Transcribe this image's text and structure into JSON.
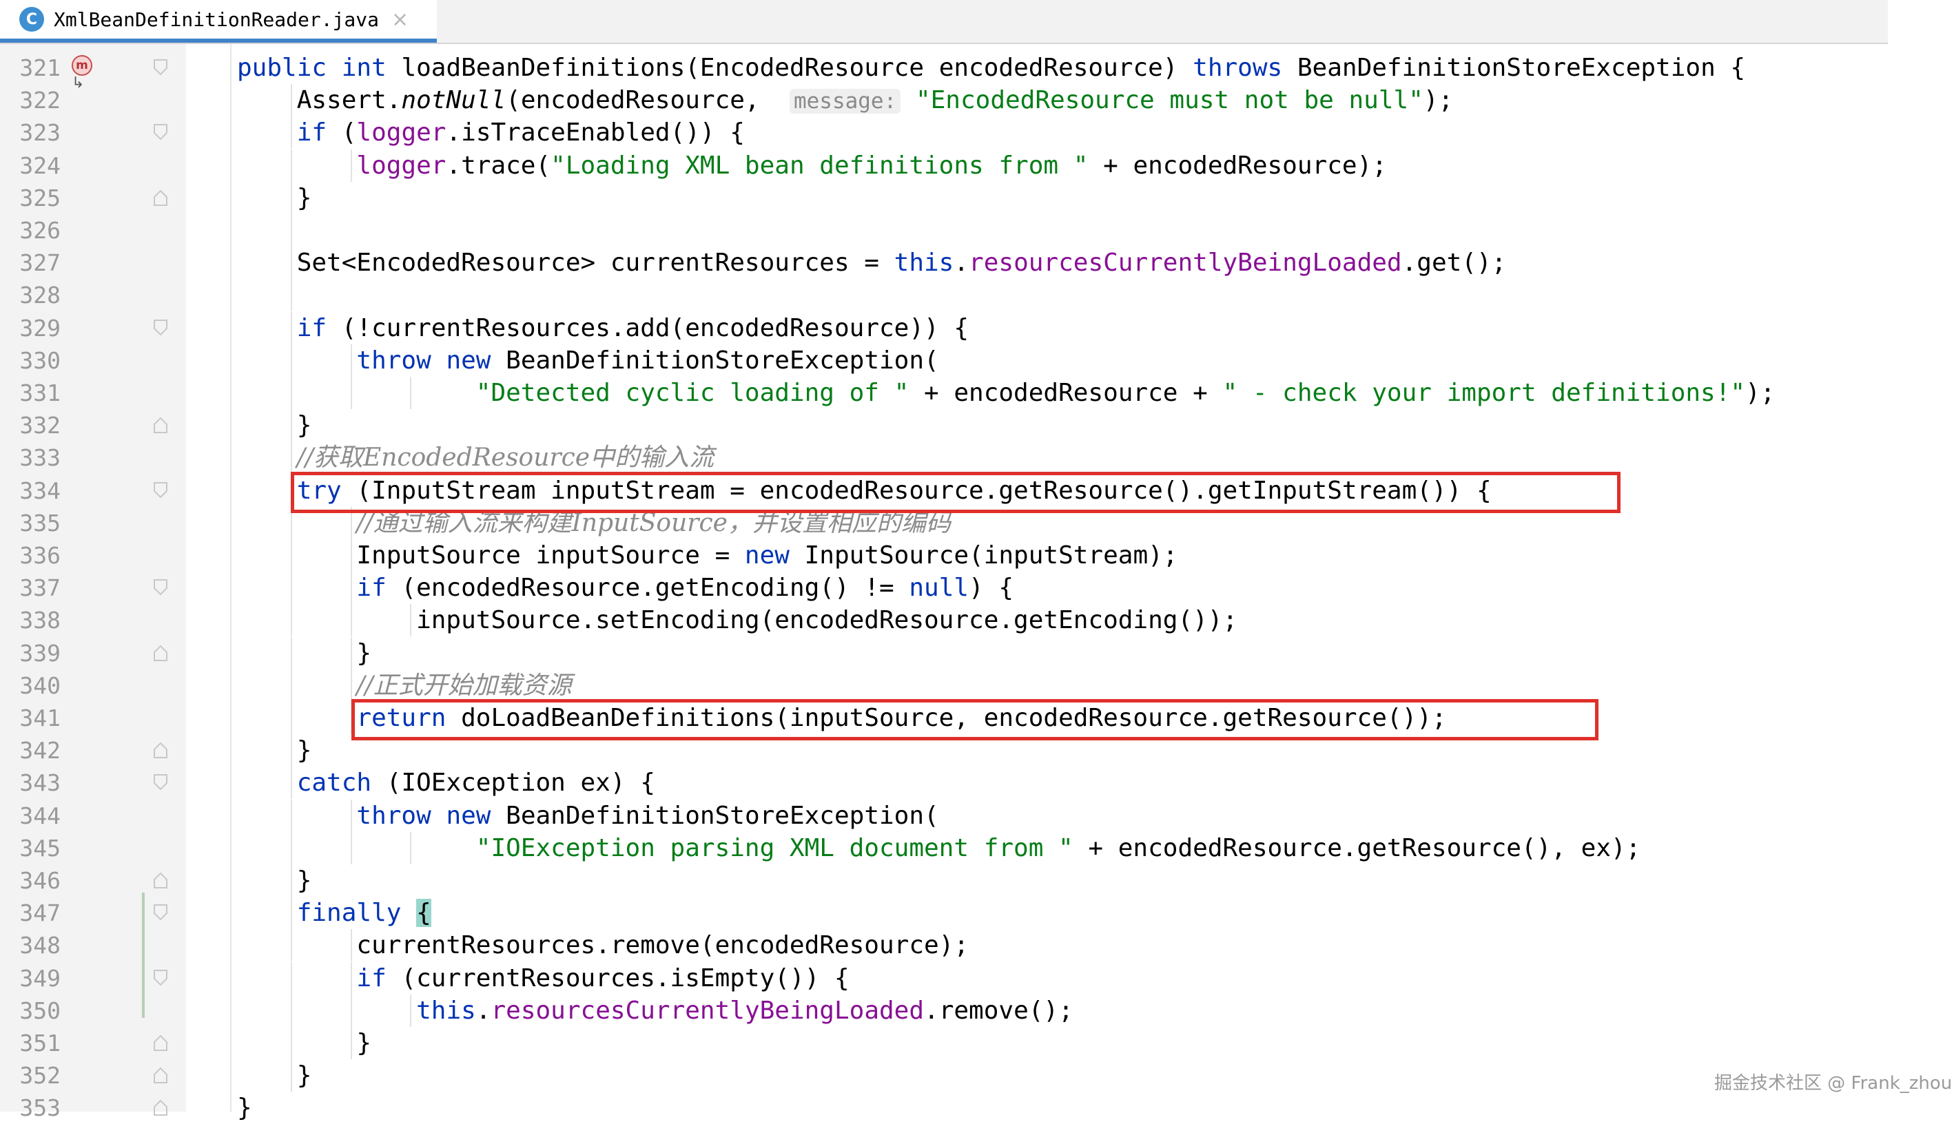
{
  "tab": {
    "icon_letter": "C",
    "file_name": "XmlBeanDefinitionReader.java",
    "close_glyph": "×"
  },
  "gutter": {
    "method_icon_letter": "m"
  },
  "lines": [
    {
      "num": "321",
      "tokens": [
        {
          "t": "public",
          "c": "kw"
        },
        {
          "t": " "
        },
        {
          "t": "int",
          "c": "kw"
        },
        {
          "t": " loadBeanDefinitions(EncodedResource encodedResource) "
        },
        {
          "t": "throws",
          "c": "kw"
        },
        {
          "t": " BeanDefinitionStoreException {"
        }
      ]
    },
    {
      "num": "322",
      "tokens": [
        {
          "t": "    Assert."
        },
        {
          "t": "notNull",
          "c": "it"
        },
        {
          "t": "(encodedResource,  "
        },
        {
          "t": "message:",
          "c": "hint"
        },
        {
          "t": " "
        },
        {
          "t": "\"EncodedResource must not be null\"",
          "c": "str"
        },
        {
          "t": ");"
        }
      ]
    },
    {
      "num": "323",
      "tokens": [
        {
          "t": "    "
        },
        {
          "t": "if",
          "c": "kw"
        },
        {
          "t": " ("
        },
        {
          "t": "logger",
          "c": "fld"
        },
        {
          "t": ".isTraceEnabled()) {"
        }
      ]
    },
    {
      "num": "324",
      "tokens": [
        {
          "t": "        "
        },
        {
          "t": "logger",
          "c": "fld"
        },
        {
          "t": ".trace("
        },
        {
          "t": "\"Loading XML bean definitions from \"",
          "c": "str"
        },
        {
          "t": " + encodedResource);"
        }
      ]
    },
    {
      "num": "325",
      "tokens": [
        {
          "t": "    }"
        }
      ]
    },
    {
      "num": "326",
      "tokens": []
    },
    {
      "num": "327",
      "tokens": [
        {
          "t": "    Set<EncodedResource> currentResources = "
        },
        {
          "t": "this",
          "c": "kw"
        },
        {
          "t": "."
        },
        {
          "t": "resourcesCurrentlyBeingLoaded",
          "c": "fld"
        },
        {
          "t": ".get();"
        }
      ]
    },
    {
      "num": "328",
      "tokens": []
    },
    {
      "num": "329",
      "tokens": [
        {
          "t": "    "
        },
        {
          "t": "if",
          "c": "kw"
        },
        {
          "t": " (!currentResources.add(encodedResource)) {"
        }
      ]
    },
    {
      "num": "330",
      "tokens": [
        {
          "t": "        "
        },
        {
          "t": "throw",
          "c": "kw"
        },
        {
          "t": " "
        },
        {
          "t": "new",
          "c": "kw"
        },
        {
          "t": " BeanDefinitionStoreException("
        }
      ]
    },
    {
      "num": "331",
      "tokens": [
        {
          "t": "                "
        },
        {
          "t": "\"Detected cyclic loading of \"",
          "c": "str"
        },
        {
          "t": " + encodedResource + "
        },
        {
          "t": "\" - check your import definitions!\"",
          "c": "str"
        },
        {
          "t": ");"
        }
      ]
    },
    {
      "num": "332",
      "tokens": [
        {
          "t": "    }"
        }
      ]
    },
    {
      "num": "333",
      "tokens": [
        {
          "t": "    "
        },
        {
          "t": "//获取EncodedResource中的输入流",
          "c": "cmt"
        }
      ]
    },
    {
      "num": "334",
      "tokens": [
        {
          "t": "    "
        },
        {
          "t": "try",
          "c": "kw"
        },
        {
          "t": " (InputStream inputStream = encodedResource.getResource().getInputStream()) {"
        }
      ]
    },
    {
      "num": "335",
      "tokens": [
        {
          "t": "        "
        },
        {
          "t": "//通过输入流来构建InputSource，并设置相应的编码",
          "c": "cmt"
        }
      ]
    },
    {
      "num": "336",
      "tokens": [
        {
          "t": "        InputSource inputSource = "
        },
        {
          "t": "new",
          "c": "kw"
        },
        {
          "t": " InputSource(inputStream);"
        }
      ]
    },
    {
      "num": "337",
      "tokens": [
        {
          "t": "        "
        },
        {
          "t": "if",
          "c": "kw"
        },
        {
          "t": " (encodedResource.getEncoding() != "
        },
        {
          "t": "null",
          "c": "kw"
        },
        {
          "t": ") {"
        }
      ]
    },
    {
      "num": "338",
      "tokens": [
        {
          "t": "            inputSource.setEncoding(encodedResource.getEncoding());"
        }
      ]
    },
    {
      "num": "339",
      "tokens": [
        {
          "t": "        }"
        }
      ]
    },
    {
      "num": "340",
      "tokens": [
        {
          "t": "        "
        },
        {
          "t": "//正式开始加载资源",
          "c": "cmt"
        }
      ]
    },
    {
      "num": "341",
      "tokens": [
        {
          "t": "        "
        },
        {
          "t": "return",
          "c": "kw"
        },
        {
          "t": " doLoadBeanDefinitions(inputSource, encodedResource.getResource());"
        }
      ]
    },
    {
      "num": "342",
      "tokens": [
        {
          "t": "    }"
        }
      ]
    },
    {
      "num": "343",
      "tokens": [
        {
          "t": "    "
        },
        {
          "t": "catch",
          "c": "kw"
        },
        {
          "t": " (IOException ex) {"
        }
      ]
    },
    {
      "num": "344",
      "tokens": [
        {
          "t": "        "
        },
        {
          "t": "throw",
          "c": "kw"
        },
        {
          "t": " "
        },
        {
          "t": "new",
          "c": "kw"
        },
        {
          "t": " BeanDefinitionStoreException("
        }
      ]
    },
    {
      "num": "345",
      "tokens": [
        {
          "t": "                "
        },
        {
          "t": "\"IOException parsing XML document from \"",
          "c": "str"
        },
        {
          "t": " + encodedResource.getResource(), ex);"
        }
      ]
    },
    {
      "num": "346",
      "tokens": [
        {
          "t": "    }"
        }
      ]
    },
    {
      "num": "347",
      "tokens": [
        {
          "t": "    "
        },
        {
          "t": "finally",
          "c": "kw"
        },
        {
          "t": " "
        },
        {
          "t": "{",
          "c": "brace-hl"
        }
      ]
    },
    {
      "num": "348",
      "tokens": [
        {
          "t": "        currentResources.remove(encodedResource);"
        }
      ]
    },
    {
      "num": "349",
      "tokens": [
        {
          "t": "        "
        },
        {
          "t": "if",
          "c": "kw"
        },
        {
          "t": " (currentResources.isEmpty()) {"
        }
      ]
    },
    {
      "num": "350",
      "tokens": [
        {
          "t": "            "
        },
        {
          "t": "this",
          "c": "kw"
        },
        {
          "t": "."
        },
        {
          "t": "resourcesCurrentlyBeingLoaded",
          "c": "fld"
        },
        {
          "t": ".remove();"
        }
      ]
    },
    {
      "num": "351",
      "tokens": [
        {
          "t": "        }"
        }
      ]
    },
    {
      "num": "352",
      "tokens": [
        {
          "t": "    }"
        }
      ]
    },
    {
      "num": "353",
      "tokens": [
        {
          "t": "}"
        }
      ]
    }
  ],
  "fold_open_lines": [
    "321",
    "323",
    "329",
    "334",
    "337",
    "343",
    "347",
    "349"
  ],
  "fold_close_lines": [
    "325",
    "332",
    "339",
    "342",
    "346",
    "351",
    "352",
    "353"
  ],
  "watermark": "掘金技术社区 @ Frank_zhou"
}
